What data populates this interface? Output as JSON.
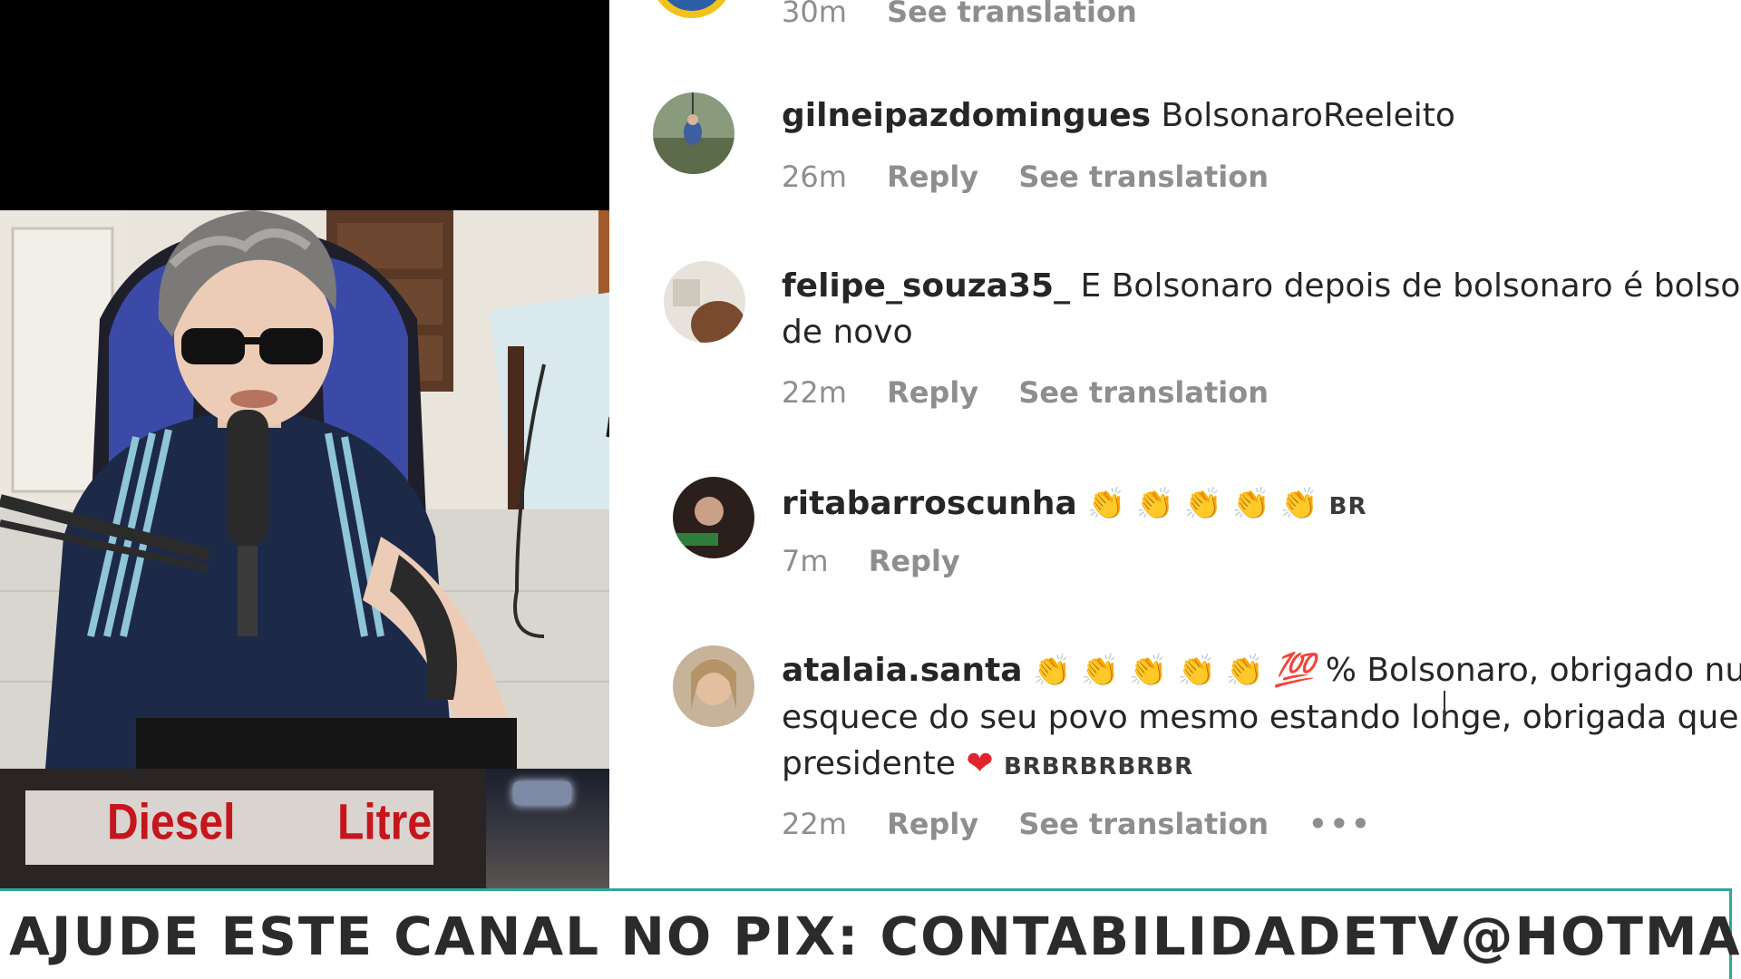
{
  "stream": {
    "banner_text": "AJUDE ESTE CANAL NO PIX: CONTABILIDADETV@HOTMAIL.COM",
    "fuel_sign": {
      "left_label": "Diesel",
      "right_label": "Litre"
    }
  },
  "comments": [
    {
      "username": "",
      "text": "",
      "time": "30m",
      "actions": [
        "See translation"
      ]
    },
    {
      "username": "gilneipazdomingues",
      "text": "BolsonaroReeleito",
      "time": "26m",
      "actions": [
        "Reply",
        "See translation"
      ]
    },
    {
      "username": "felipe_souza35_",
      "text_line1": "E Bolsonaro depois de bolsonaro é bolsonar",
      "text_line2": "de novo",
      "time": "22m",
      "actions": [
        "Reply",
        "See translation"
      ]
    },
    {
      "username": "ritabarroscunha",
      "emoji_string": "👏 👏 👏 👏 👏",
      "flag": "BR",
      "time": "7m",
      "actions": [
        "Reply"
      ]
    },
    {
      "username": "atalaia.santa",
      "emoji_string": "👏 👏 👏 👏 👏",
      "hundred": "💯",
      "text_line1": "% Bolsonaro, obrigado nunc",
      "text_line2": "esquece do seu povo mesmo estando longe, obrigada queric",
      "text_line3": "presidente",
      "heart": "❤",
      "flags": "BRBRBRBRBR",
      "time": "22m",
      "actions": [
        "Reply",
        "See translation"
      ],
      "more": "•••"
    }
  ],
  "icons": {
    "more": "more-options-icon",
    "clap": "clapping-hands-icon",
    "heart": "red-heart-icon",
    "hundred": "hundred-points-icon"
  },
  "colors": {
    "banner_border": "#2fa79a",
    "meta_text": "#8e8e8e",
    "primary_text": "#262626",
    "fuel_red": "#c5161d"
  }
}
